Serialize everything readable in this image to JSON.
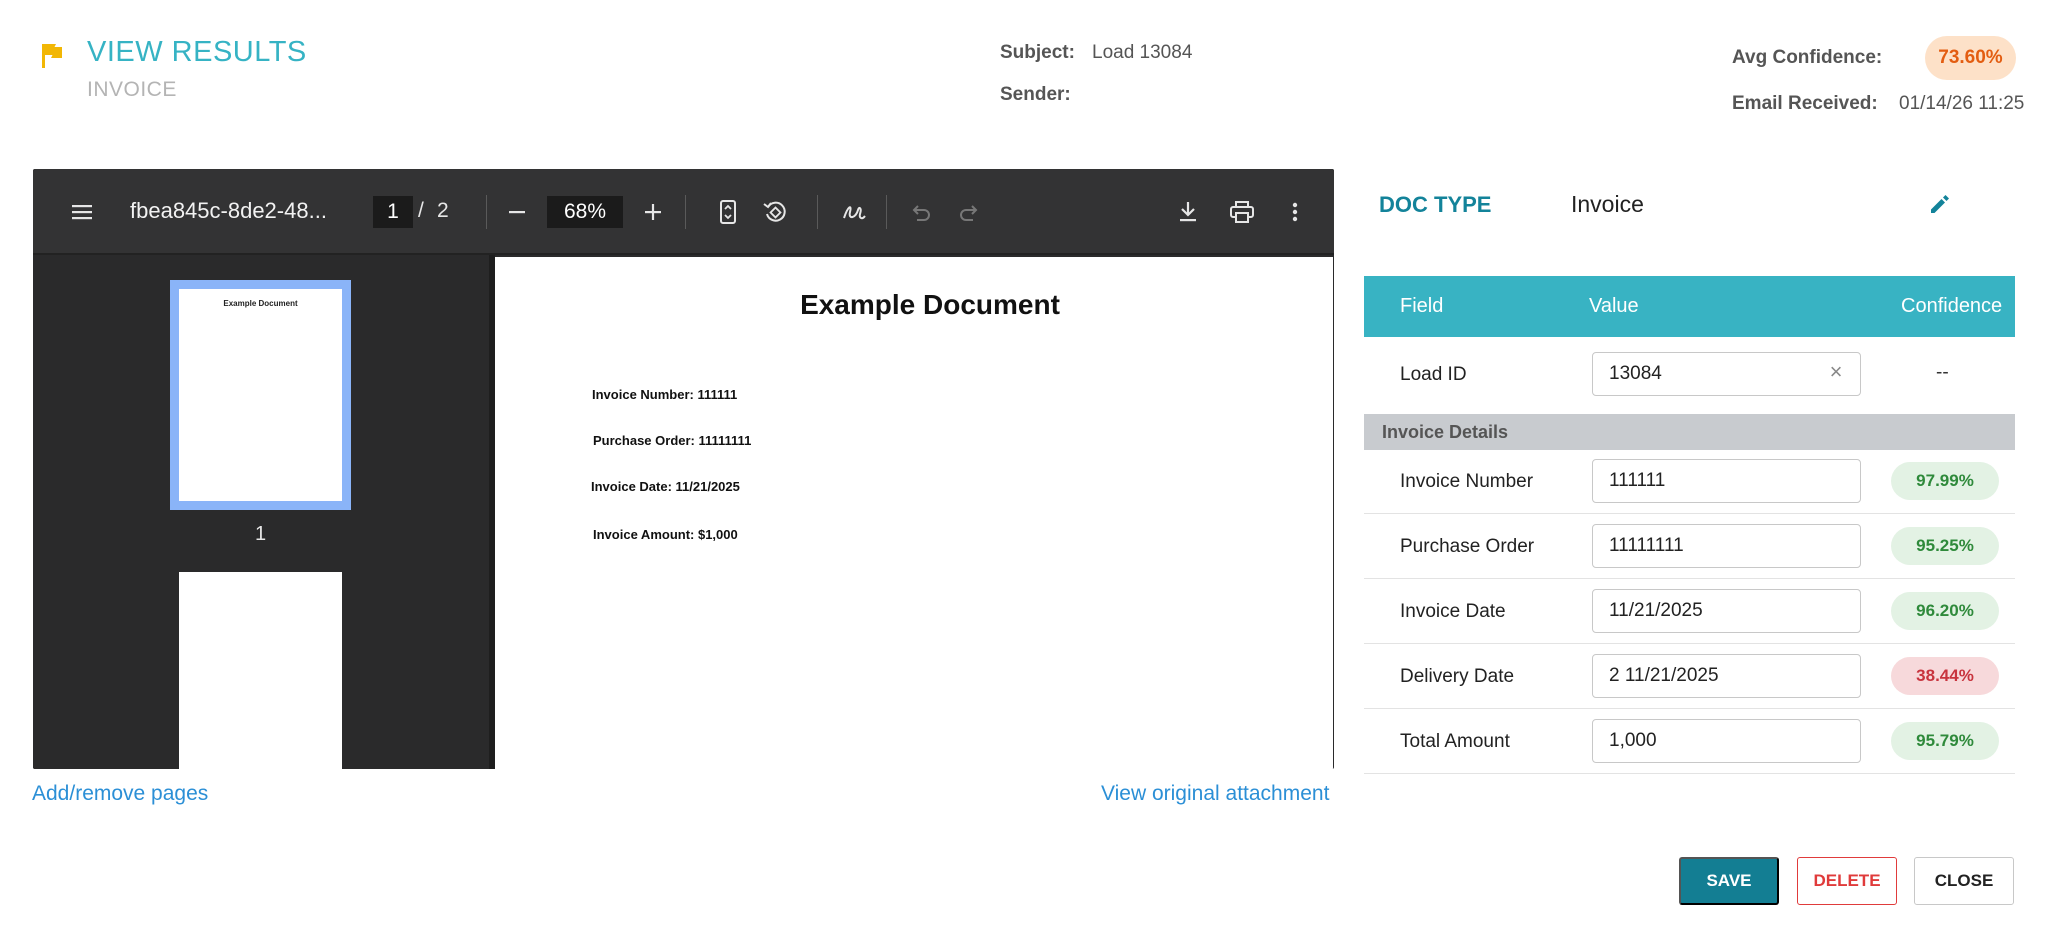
{
  "header": {
    "title": "VIEW RESULTS",
    "subtitle": "INVOICE",
    "subject_label": "Subject:",
    "subject_value": "Load 13084",
    "sender_label": "Sender:",
    "sender_value": "",
    "avg_confidence_label": "Avg Confidence:",
    "avg_confidence_value": "73.60%",
    "email_received_label": "Email Received:",
    "email_received_value": "01/14/26 11:25",
    "flag_color": "#f2b705",
    "accent": "#36b3c4"
  },
  "viewer": {
    "filename": "fbea845c-8de2-48...",
    "page_current": "1",
    "page_sep": "/",
    "page_total": "2",
    "zoom": "68%",
    "icons": [
      "menu-icon",
      "zoom-out-icon",
      "zoom-in-icon",
      "fit-page-icon",
      "rotate-icon",
      "annotate-icon",
      "undo-icon",
      "redo-icon",
      "download-icon",
      "print-icon",
      "more-vert-icon"
    ],
    "thumbnail_title": "Example Document",
    "thumbnail_page_number": "1",
    "document": {
      "title": "Example Document",
      "lines": [
        "Invoice Number: 111111",
        "Purchase Order: 11111111",
        "Invoice Date: 11/21/2025",
        "Invoice Amount: $1,000"
      ]
    }
  },
  "links": {
    "add_remove_pages": "Add/remove pages",
    "view_original": "View original attachment"
  },
  "panel": {
    "doc_type_label": "DOC TYPE",
    "doc_type_value": "Invoice",
    "columns": [
      "Field",
      "Value",
      "Confidence"
    ],
    "load_id": {
      "label": "Load ID",
      "value": "13084",
      "confidence": "--"
    },
    "section_label": "Invoice Details",
    "rows": [
      {
        "label": "Invoice Number",
        "value": "111111",
        "confidence": "97.99%",
        "status": "good"
      },
      {
        "label": "Purchase Order",
        "value": "11111111",
        "confidence": "95.25%",
        "status": "good"
      },
      {
        "label": "Invoice Date",
        "value": "11/21/2025",
        "confidence": "96.20%",
        "status": "good"
      },
      {
        "label": "Delivery Date",
        "value": "2 11/21/2025",
        "confidence": "38.44%",
        "status": "bad"
      },
      {
        "label": "Total Amount",
        "value": "1,000",
        "confidence": "95.79%",
        "status": "good"
      }
    ]
  },
  "actions": {
    "save": "SAVE",
    "delete": "DELETE",
    "close": "CLOSE"
  }
}
